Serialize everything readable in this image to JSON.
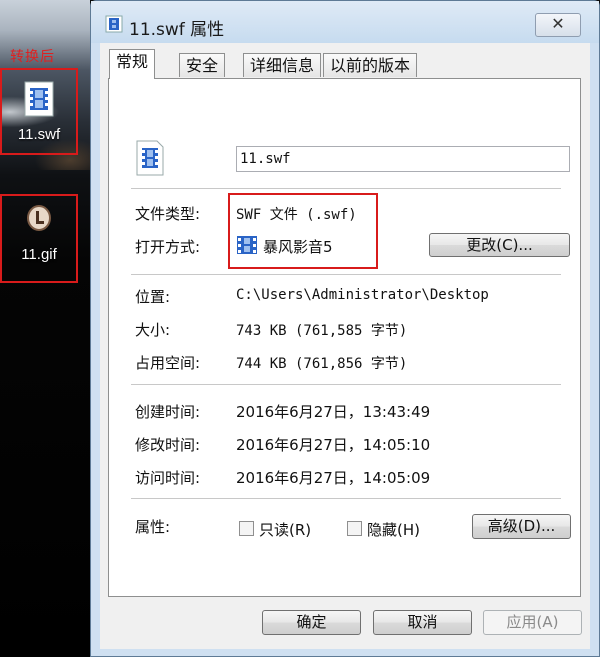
{
  "desktop": {
    "convert_label": "转换后",
    "icons": [
      {
        "name": "11.swf"
      },
      {
        "name": "11.gif"
      }
    ]
  },
  "window": {
    "title": "11.swf 属性",
    "close_symbol": "✕"
  },
  "tabs": [
    {
      "label": "常规",
      "active": true
    },
    {
      "label": "安全"
    },
    {
      "label": "详细信息"
    },
    {
      "label": "以前的版本"
    }
  ],
  "general": {
    "file_name": "11.swf",
    "file_type_label": "文件类型:",
    "file_type_value": "SWF 文件 (.swf)",
    "opens_with_label": "打开方式:",
    "opens_with_value": "暴风影音5",
    "change_button": "更改(C)...",
    "location_label": "位置:",
    "location_value": "C:\\Users\\Administrator\\Desktop",
    "size_label": "大小:",
    "size_value": "743 KB (761,585 字节)",
    "size_on_disk_label": "占用空间:",
    "size_on_disk_value": "744 KB (761,856 字节)",
    "created_label": "创建时间:",
    "created_value": "2016年6月27日，13:43:49",
    "modified_label": "修改时间:",
    "modified_value": "2016年6月27日，14:05:10",
    "accessed_label": "访问时间:",
    "accessed_value": "2016年6月27日，14:05:09",
    "attributes_label": "属性:",
    "readonly_label": "只读(R)",
    "hidden_label": "隐藏(H)",
    "advanced_button": "高级(D)..."
  },
  "footer": {
    "ok": "确定",
    "cancel": "取消",
    "apply": "应用(A)"
  },
  "colors": {
    "highlight_red": "#d81b1b",
    "window_frame": "#cfe0f1",
    "icon_blue": "#2a64c6"
  }
}
